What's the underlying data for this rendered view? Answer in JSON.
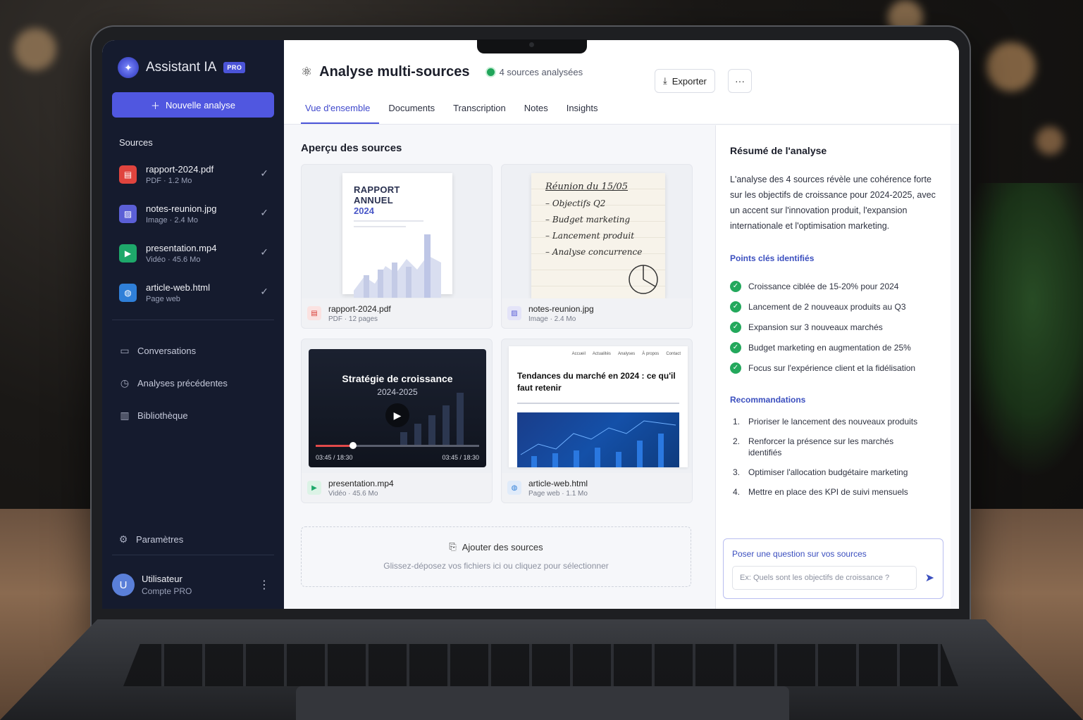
{
  "sidebar": {
    "brand": "Assistant IA",
    "badge": "PRO",
    "new_button": "Nouvelle analyse",
    "sources_label": "Sources",
    "sources": [
      {
        "name": "rapport-2024.pdf",
        "meta": "PDF · 1.2 Mo",
        "icon": "pdf-icon",
        "color": "#e0443e"
      },
      {
        "name": "notes-reunion.jpg",
        "meta": "Image · 2.4 Mo",
        "icon": "image-icon",
        "color": "#5b5fd6"
      },
      {
        "name": "presentation.mp4",
        "meta": "Vidéo · 45.6 Mo",
        "icon": "play-icon",
        "color": "#1ea86a"
      },
      {
        "name": "article-web.html",
        "meta": "Page web",
        "icon": "globe-icon",
        "color": "#2f7fd8"
      }
    ],
    "nav": [
      {
        "label": "Conversations",
        "icon": "chat-icon"
      },
      {
        "label": "Analyses précédentes",
        "icon": "clock-icon"
      },
      {
        "label": "Bibliothèque",
        "icon": "library-icon"
      }
    ],
    "settings": "Paramètres",
    "user": {
      "initial": "U",
      "name": "Utilisateur",
      "plan": "Compte PRO"
    }
  },
  "header": {
    "title": "Analyse multi-sources",
    "status": "4 sources analysées",
    "export": "Exporter",
    "more": "···",
    "tabs": [
      "Vue d'ensemble",
      "Documents",
      "Transcription",
      "Notes",
      "Insights"
    ],
    "active_tab": 0
  },
  "overview": {
    "title": "Aperçu des sources",
    "cards": [
      {
        "name": "rapport-2024.pdf",
        "meta": "PDF · 12 pages",
        "preview_title": "RAPPORT ANNUEL",
        "preview_year": "2024"
      },
      {
        "name": "notes-reunion.jpg",
        "meta": "Image · 2.4 Mo",
        "note_title": "Réunion du 15/05",
        "note_lines": [
          "– Objectifs Q2",
          "– Budget marketing",
          "– Lancement produit",
          "– Analyse concurrence"
        ]
      },
      {
        "name": "presentation.mp4",
        "meta": "Vidéo · 45.6 Mo",
        "video_title": "Stratégie de croissance",
        "video_sub": "2024-2025",
        "time": "03:45 / 18:30",
        "progress": 0.23
      },
      {
        "name": "article-web.html",
        "meta": "Page web · 1.1 Mo",
        "web_nav": [
          "Accueil",
          "Actualités",
          "Analyses",
          "À propos",
          "Contact"
        ],
        "web_title": "Tendances du marché en 2024 : ce qu'il faut retenir"
      }
    ],
    "dropzone_title": "Ajouter des sources",
    "dropzone_sub": "Glissez-déposez vos fichiers ici ou cliquez pour sélectionner"
  },
  "panel": {
    "title": "Résumé de l'analyse",
    "summary": "L'analyse des 4 sources révèle une cohérence forte sur les objectifs de croissance pour 2024-2025, avec un accent sur l'innovation produit, l'expansion internationale et l'optimisation marketing.",
    "key_title": "Points clés identifiés",
    "key_points": [
      "Croissance ciblée de 15-20% pour 2024",
      "Lancement de 2 nouveaux produits au Q3",
      "Expansion sur 3 nouveaux marchés",
      "Budget marketing en augmentation de 25%",
      "Focus sur l'expérience client et la fidélisation"
    ],
    "reco_title": "Recommandations",
    "recommendations": [
      "Prioriser le lancement des nouveaux produits",
      "Renforcer la présence sur les marchés identifiés",
      "Optimiser l'allocation budgétaire marketing",
      "Mettre en place des KPI de suivi mensuels"
    ],
    "ask_label": "Poser une question sur vos sources",
    "ask_placeholder": "Ex: Quels sont les objectifs de croissance ?"
  }
}
